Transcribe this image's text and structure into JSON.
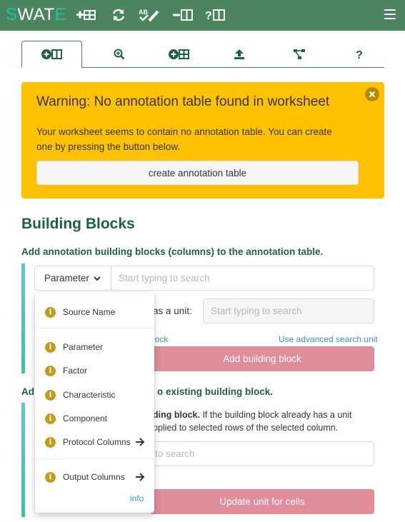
{
  "app": {
    "logo_s": "S",
    "logo_rest": "WAT",
    "logo_e": "E"
  },
  "toolbar": {
    "icons": [
      "add-table-icon",
      "refresh-icon",
      "spellcheck-edit-icon",
      "remove-column-icon",
      "help-column-icon"
    ],
    "menu_icon": "hamburger-menu-icon"
  },
  "tabs": [
    {
      "name": "tab-add-building-block",
      "icon": "add-column-icon",
      "active": true
    },
    {
      "name": "tab-term-search",
      "icon": "search-plus-icon",
      "active": false
    },
    {
      "name": "tab-add-table",
      "icon": "add-table-icon",
      "active": false
    },
    {
      "name": "tab-upload",
      "icon": "upload-icon",
      "active": false
    },
    {
      "name": "tab-protocol-graph",
      "icon": "graph-icon",
      "active": false
    },
    {
      "name": "tab-help",
      "icon": "question-icon",
      "active": false
    }
  ],
  "warning": {
    "title": "Warning: No annotation table found in worksheet",
    "body": "Your worksheet seems to contain no annotation table. You can create one by pressing the button below.",
    "button": "create annotation table",
    "color": "#ffc100"
  },
  "building_blocks": {
    "heading": "Building Blocks",
    "subheading": "Add annotation building blocks (columns) to the annotation table.",
    "type_select": "Parameter",
    "search_placeholder": "Start typing to search",
    "unit_label_fragment": "as a unit:",
    "unit_placeholder": "Start typing to search",
    "link_fragment": "lock",
    "advanced_link": "Use advanced search unit",
    "add_button": "Add building block"
  },
  "unit_update": {
    "heading_start": "Ad",
    "heading_end": "o existing building block.",
    "desc_bold_fragment": "ding block.",
    "desc_rest_1": " If the building block already has a unit",
    "desc_line_2": "pplied to selected rows of the selected column.",
    "input_fragment": "to search",
    "update_button": "Update unit for cells"
  },
  "dropdown": {
    "items": [
      {
        "label": "Source Name",
        "has_arrow": false
      },
      {
        "label": "Parameter",
        "has_arrow": false
      },
      {
        "label": "Factor",
        "has_arrow": false
      },
      {
        "label": "Characteristic",
        "has_arrow": false
      },
      {
        "label": "Component",
        "has_arrow": false
      },
      {
        "label": "Protocol Columns",
        "has_arrow": true
      },
      {
        "label": "Output Columns",
        "has_arrow": true
      }
    ],
    "info_glyph": "i",
    "info_link": "info"
  },
  "colors": {
    "topbar": "#4a8560",
    "accent_text": "#1f5f45",
    "pink_button": "#e08c99",
    "link": "#3e8ed0"
  }
}
